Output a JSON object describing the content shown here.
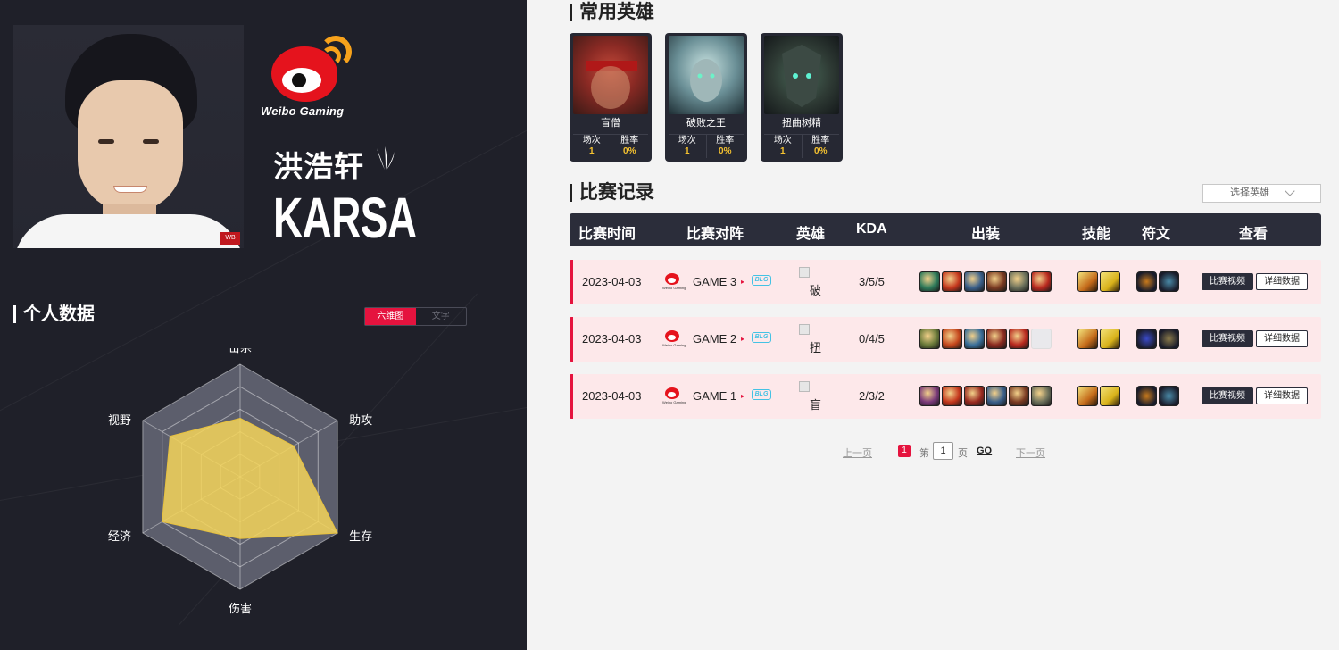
{
  "player": {
    "name": "洪浩轩",
    "id": "KARSA",
    "team_logo_text": "Weibo Gaming",
    "role_icon": "jungle-claw-icon"
  },
  "stats_section": {
    "title": "个人数据",
    "toggle": [
      "六维图",
      "文字"
    ],
    "active_toggle": "六维图"
  },
  "radar": {
    "axes": [
      "击杀",
      "助攻",
      "生存",
      "伤害",
      "经济",
      "视野"
    ],
    "values": [
      0.52,
      0.55,
      1.0,
      0.55,
      0.8,
      0.72
    ],
    "fill_color": "#f5d55a"
  },
  "common_heroes": {
    "title": "常用英雄",
    "stat_labels": [
      "场次",
      "胜率"
    ],
    "heroes": [
      {
        "name": "盲僧",
        "games": "1",
        "winrate": "0%",
        "color": "#8b2a24"
      },
      {
        "name": "破败之王",
        "games": "1",
        "winrate": "0%",
        "color": "#6a8f96"
      },
      {
        "name": "扭曲树精",
        "games": "1",
        "winrate": "0%",
        "color": "#3a4a3e"
      }
    ]
  },
  "records": {
    "title": "比赛记录",
    "select_placeholder": "选择英雄",
    "headers": [
      "比赛时间",
      "比赛对阵",
      "英雄",
      "KDA",
      "出装",
      "技能",
      "符文",
      "查看"
    ],
    "team_logo_text": "Weibo Gaming",
    "rows": [
      {
        "date": "2023-04-03",
        "game": "GAME 3",
        "hero_alt": "破",
        "kda": "3/5/5",
        "items": [
          "#2e7a5a",
          "#c4361c",
          "#3a5f8a",
          "#7a3a22",
          "#6a6f5a",
          "#b8281e"
        ],
        "skills": [
          "#c46a1a",
          "#d8b21a"
        ],
        "runes": [
          "#c87a1c",
          "#4a8aa8"
        ]
      },
      {
        "date": "2023-04-03",
        "game": "GAME 2",
        "hero_alt": "扭",
        "kda": "0/4/5",
        "items": [
          "#6a7a3a",
          "#c4461c",
          "#3a6f9a",
          "#8a2a20",
          "#b8281e",
          "empty"
        ],
        "skills": [
          "#c46a1a",
          "#d8b21a"
        ],
        "runes": [
          "#3a4ac8",
          "#8a7a4a"
        ]
      },
      {
        "date": "2023-04-03",
        "game": "GAME 1",
        "hero_alt": "盲",
        "kda": "2/3/2",
        "items": [
          "#7a3a7a",
          "#c4361c",
          "#9a2a20",
          "#3a5f8a",
          "#7a3a22",
          "#6a6f5a"
        ],
        "skills": [
          "#c46a1a",
          "#d8b21a"
        ],
        "runes": [
          "#c87a1c",
          "#4a8aa8"
        ]
      }
    ],
    "actions": {
      "video": "比赛视频",
      "detail": "详细数据"
    },
    "opponent_abbr": "BLG",
    "vs_mark": "▸"
  },
  "pager": {
    "prev": "上一页",
    "current": "1",
    "page_prefix": "第",
    "page_input": "1",
    "page_suffix": "页",
    "go": "GO",
    "next": "下一页"
  }
}
